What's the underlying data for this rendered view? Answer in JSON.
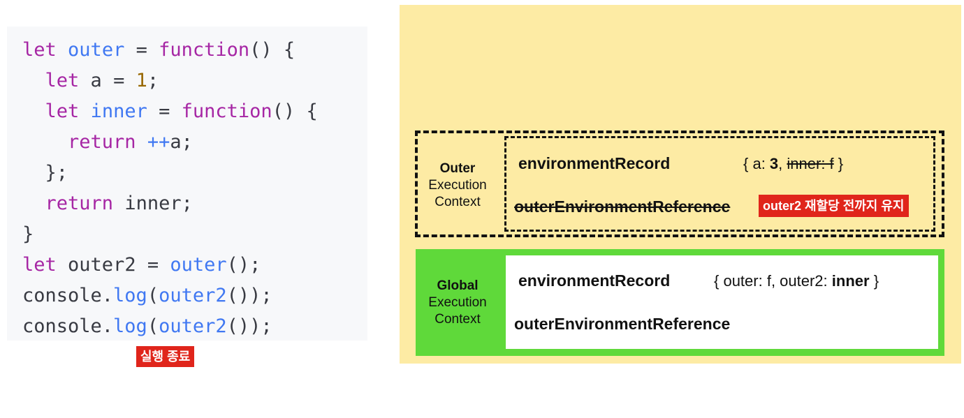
{
  "code": {
    "lines": [
      [
        {
          "t": "let",
          "c": "kw"
        },
        {
          "t": " "
        },
        {
          "t": "outer",
          "c": "fn"
        },
        {
          "t": " = "
        },
        {
          "t": "function",
          "c": "kw"
        },
        {
          "t": "() {"
        }
      ],
      [
        {
          "t": "  "
        },
        {
          "t": "let",
          "c": "kw"
        },
        {
          "t": " a = "
        },
        {
          "t": "1",
          "c": "num"
        },
        {
          "t": ";"
        }
      ],
      [
        {
          "t": "  "
        },
        {
          "t": "let",
          "c": "kw"
        },
        {
          "t": " "
        },
        {
          "t": "inner",
          "c": "fn"
        },
        {
          "t": " = "
        },
        {
          "t": "function",
          "c": "kw"
        },
        {
          "t": "() {"
        }
      ],
      [
        {
          "t": "    "
        },
        {
          "t": "return",
          "c": "kw"
        },
        {
          "t": " "
        },
        {
          "t": "++",
          "c": "fn"
        },
        {
          "t": "a;"
        }
      ],
      [
        {
          "t": "  };"
        }
      ],
      [
        {
          "t": "  "
        },
        {
          "t": "return",
          "c": "kw"
        },
        {
          "t": " inner;"
        }
      ],
      [
        {
          "t": "}"
        }
      ],
      [
        {
          "t": "let",
          "c": "kw"
        },
        {
          "t": " outer2 = "
        },
        {
          "t": "outer",
          "c": "fn"
        },
        {
          "t": "();"
        }
      ],
      [
        {
          "t": "console."
        },
        {
          "t": "log",
          "c": "fn"
        },
        {
          "t": "("
        },
        {
          "t": "outer2",
          "c": "fn"
        },
        {
          "t": "());"
        }
      ],
      [
        {
          "t": "console."
        },
        {
          "t": "log",
          "c": "fn"
        },
        {
          "t": "("
        },
        {
          "t": "outer2",
          "c": "fn"
        },
        {
          "t": "());"
        }
      ]
    ],
    "end_badge": "실행 종료"
  },
  "outer_context": {
    "label_title": "Outer",
    "label_line1": "Execution",
    "label_line2": "Context",
    "env_record_label": "environmentRecord",
    "record_open": "{ a: ",
    "record_a_value": "3",
    "record_sep": ",  ",
    "record_inner": "inner: f",
    "record_close": " }",
    "outer_env_ref_label": "outerEnvironmentReference",
    "retain_badge": "outer2 재할당 전까지 유지"
  },
  "global_context": {
    "label_title": "Global",
    "label_line1": "Execution",
    "label_line2": "Context",
    "env_record_label": "environmentRecord",
    "record_open": "{ outer: f,   outer2: ",
    "record_outer2_value": "inner",
    "record_close": " }",
    "outer_env_ref_label": "outerEnvironmentReference"
  },
  "colors": {
    "keyword": "#a626a4",
    "function": "#4078f2",
    "number": "#986801",
    "badge": "#e0251b",
    "context_bg": "#fdeba4",
    "global_bg": "#5fd93a"
  }
}
